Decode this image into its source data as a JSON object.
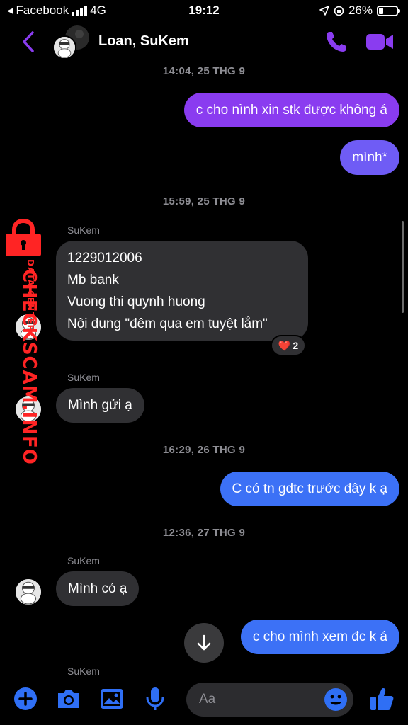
{
  "status_bar": {
    "back_app": "Facebook",
    "network": "4G",
    "time": "19:12",
    "battery": "26%",
    "battery_level": 0.26
  },
  "header": {
    "title": "Loan, SuKem"
  },
  "messages": {
    "ts1": "14:04, 25 THG 9",
    "m1": "c cho nình xin stk được không á",
    "m2": "mình*",
    "ts2": "15:59, 25 THG 9",
    "sender1": "SuKem",
    "m3_line1": "1229012006",
    "m3_line2": "Mb bank",
    "m3_line3": "Vuong thi quynh huong",
    "m3_line4": "Nội dung \"đêm qua em tuyệt lắm\"",
    "m3_reaction_emoji": "❤️",
    "m3_reaction_count": "2",
    "sender2": "SuKem",
    "m4": "Mình gửi ạ",
    "ts3": "16:29, 26 THG 9",
    "m5": "C có tn gdtc trước đây k ạ",
    "ts4": "12:36, 27 THG 9",
    "sender3": "SuKem",
    "m6": "Mình có ạ",
    "m7": "c cho mình xem đc k á",
    "sender4": "SuKem"
  },
  "watermark": {
    "brand": "CHECKSCAM.INFO",
    "tag": "DATA CENTER"
  },
  "composer": {
    "placeholder": "Aa"
  },
  "colors": {
    "accent": "#8a3cf0",
    "bubble_blue": "#3c71f6",
    "bubble_incoming": "#303033",
    "tool_blue": "#2f6ff5",
    "watermark_red": "#ff2424"
  }
}
